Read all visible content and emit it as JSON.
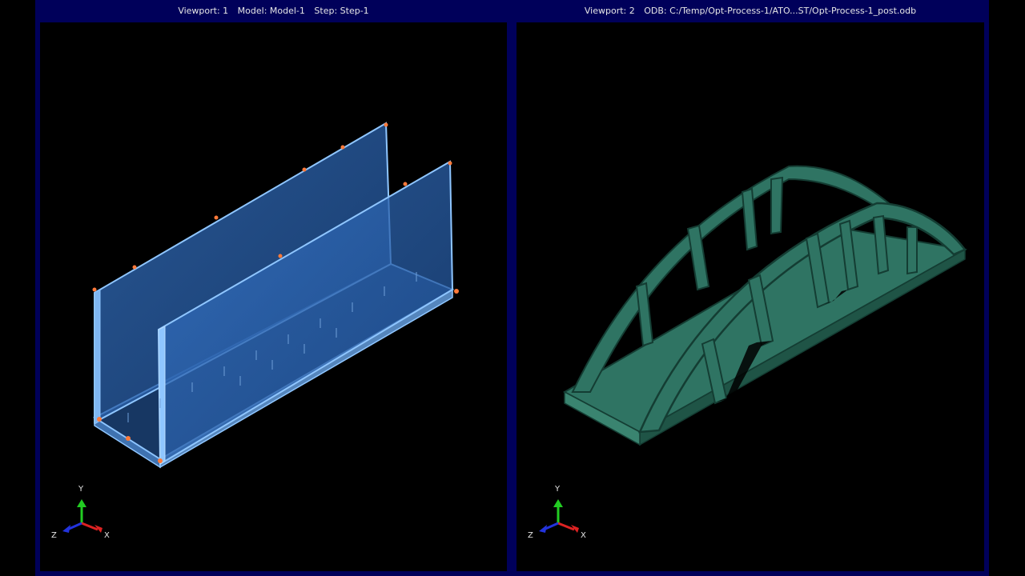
{
  "viewport1": {
    "label": "Viewport: 1",
    "model": "Model: Model-1",
    "step": "Step: Step-1"
  },
  "viewport2": {
    "label": "Viewport: 2",
    "odb": "ODB: C:/Temp/Opt-Process-1/ATO...ST/Opt-Process-1_post.odb"
  },
  "triad": {
    "x": "X",
    "y": "Y",
    "z": "Z"
  },
  "colors": {
    "titlebar": "#00005a",
    "panel_fill": "#2a64b4",
    "panel_edge": "#8fc6ff",
    "result_fill": "#2f7463",
    "result_dark": "#143d33"
  }
}
